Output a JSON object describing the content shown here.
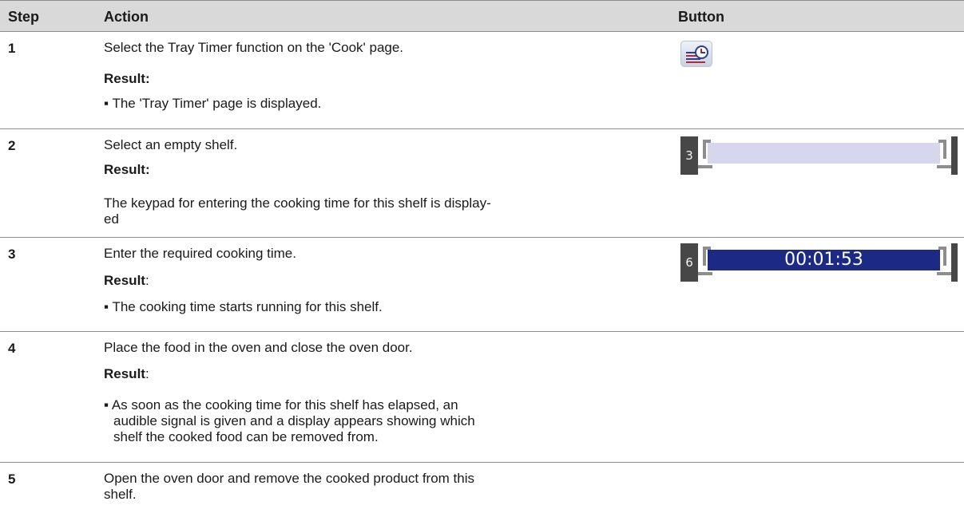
{
  "header": {
    "step": "Step",
    "action": "Action",
    "button": "Button"
  },
  "rows": [
    {
      "step": "1",
      "action": "Select the Tray Timer function on the 'Cook' page.",
      "result_label": "Result:",
      "result_lines": [
        "The 'Tray Timer' page is displayed."
      ]
    },
    {
      "step": "2",
      "action": "Select an empty shelf.",
      "result_label": "Result:",
      "result_lines": [
        "The keypad for entering the cooking time for this shelf is display-",
        "ed"
      ]
    },
    {
      "step": "3",
      "action": "Enter the required cooking time.",
      "result_label": "Result",
      "result_colon": ":",
      "result_lines": [
        "The cooking time starts running for this shelf."
      ]
    },
    {
      "step": "4",
      "action": "Place the food in the oven and close the oven door.",
      "result_label": "Result",
      "result_colon": ":",
      "result_lines": [
        "As soon as the cooking time for this shelf has elapsed, an",
        "audible signal is given and a display appears showing which",
        "shelf the cooked food can be removed from."
      ]
    },
    {
      "step": "5",
      "action_lines": [
        "Open the oven door and remove the cooked product from this",
        "shelf."
      ]
    }
  ],
  "buttons": {
    "tray_timer_icon": "tray-timer-icon",
    "shelf_empty": {
      "number": "3"
    },
    "shelf_timer": {
      "number": "6",
      "time": "00:01:53"
    }
  }
}
